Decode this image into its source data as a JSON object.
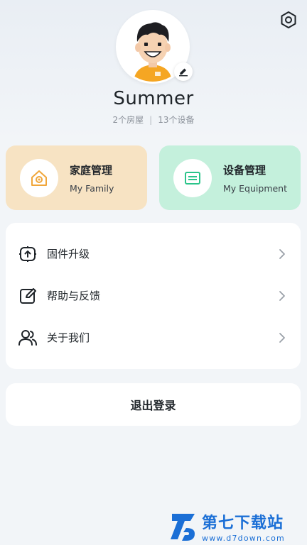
{
  "profile": {
    "name": "Summer",
    "rooms": "2个房屋",
    "separator": "|",
    "devices": "13个设备"
  },
  "cards": {
    "family": {
      "title": "家庭管理",
      "subtitle": "My Family",
      "icon": "home-gear-icon",
      "bg": "#f7e3c3"
    },
    "equipment": {
      "title": "设备管理",
      "subtitle": "My Equipment",
      "icon": "device-card-icon",
      "bg": "#c4f0dc"
    }
  },
  "menu": [
    {
      "label": "固件升级",
      "icon": "firmware-upgrade-icon"
    },
    {
      "label": "帮助与反馈",
      "icon": "edit-feedback-icon"
    },
    {
      "label": "关于我们",
      "icon": "users-icon"
    }
  ],
  "logout": {
    "label": "退出登录"
  },
  "watermark": {
    "title": "第七下载站",
    "url": "www.d7down.com"
  },
  "colors": {
    "accent_green": "#2bc48a",
    "accent_orange": "#f0a63a",
    "watermark_blue": "#1b6fd6"
  }
}
